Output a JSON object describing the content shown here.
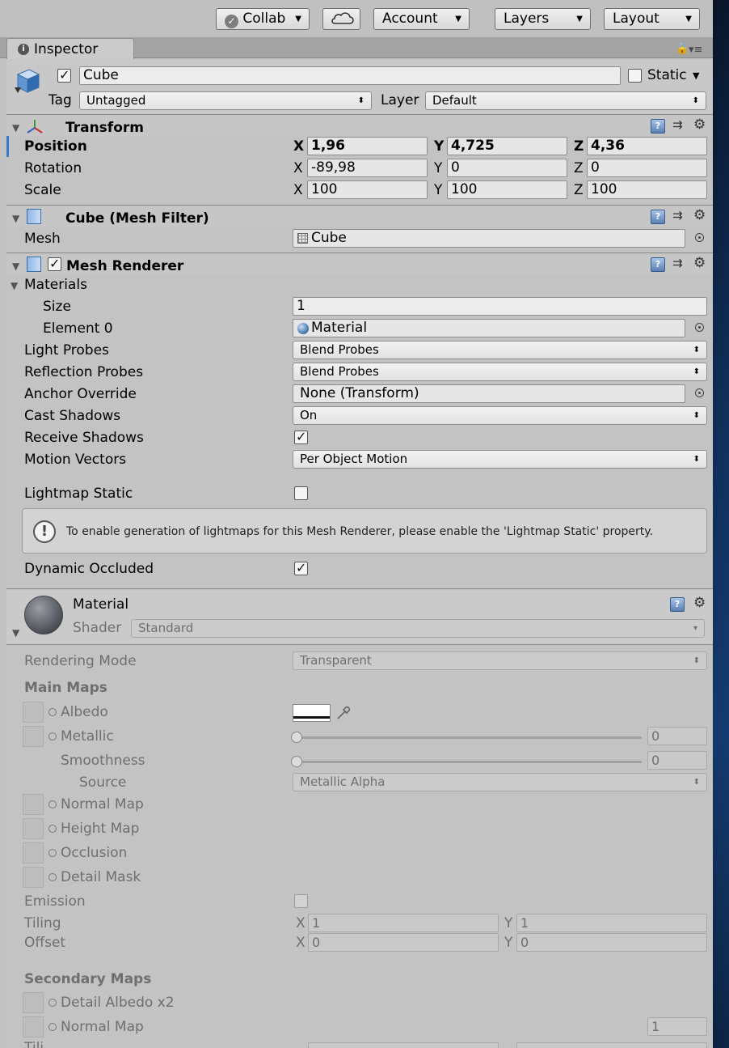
{
  "toolbar": {
    "collab": "Collab",
    "account": "Account",
    "layers": "Layers",
    "layout": "Layout"
  },
  "tab": {
    "title": "Inspector"
  },
  "object": {
    "name": "Cube",
    "active": true,
    "static_label": "Static",
    "static": false,
    "tag_label": "Tag",
    "tag": "Untagged",
    "layer_label": "Layer",
    "layer": "Default"
  },
  "transform": {
    "title": "Transform",
    "position_label": "Position",
    "rotation_label": "Rotation",
    "scale_label": "Scale",
    "axis_x": "X",
    "axis_y": "Y",
    "axis_z": "Z",
    "position": {
      "x": "1,96",
      "y": "4,725",
      "z": "4,36"
    },
    "rotation": {
      "x": "-89,98",
      "y": "0",
      "z": "0"
    },
    "scale": {
      "x": "100",
      "y": "100",
      "z": "100"
    }
  },
  "mesh_filter": {
    "title": "Cube (Mesh Filter)",
    "mesh_label": "Mesh",
    "mesh": "Cube"
  },
  "mesh_renderer": {
    "title": "Mesh Renderer",
    "enabled": true,
    "materials_label": "Materials",
    "size_label": "Size",
    "size": "1",
    "element0_label": "Element 0",
    "element0": "Material",
    "light_probes_label": "Light Probes",
    "light_probes": "Blend Probes",
    "reflection_probes_label": "Reflection Probes",
    "reflection_probes": "Blend Probes",
    "anchor_override_label": "Anchor Override",
    "anchor_override": "None (Transform)",
    "cast_shadows_label": "Cast Shadows",
    "cast_shadows": "On",
    "receive_shadows_label": "Receive Shadows",
    "receive_shadows": true,
    "motion_vectors_label": "Motion Vectors",
    "motion_vectors": "Per Object Motion",
    "lightmap_static_label": "Lightmap Static",
    "lightmap_static": false,
    "info_message": "To enable generation of lightmaps for this Mesh Renderer, please enable the 'Lightmap Static' property.",
    "dynamic_occluded_label": "Dynamic Occluded",
    "dynamic_occluded": true
  },
  "material": {
    "title": "Material",
    "shader_label": "Shader",
    "shader": "Standard",
    "rendering_mode_label": "Rendering Mode",
    "rendering_mode": "Transparent",
    "main_maps_label": "Main Maps",
    "albedo_label": "Albedo",
    "metallic_label": "Metallic",
    "metallic": "0",
    "smoothness_label": "Smoothness",
    "smoothness": "0",
    "source_label": "Source",
    "source": "Metallic Alpha",
    "normal_map_label": "Normal Map",
    "height_map_label": "Height Map",
    "occlusion_label": "Occlusion",
    "detail_mask_label": "Detail Mask",
    "emission_label": "Emission",
    "tiling_label": "Tiling",
    "tiling": {
      "x": "1",
      "y": "1"
    },
    "offset_label": "Offset",
    "offset": {
      "x": "0",
      "y": "0"
    },
    "secondary_maps_label": "Secondary Maps",
    "detail_albedo_label": "Detail Albedo x2",
    "secondary_normal_label": "Normal Map",
    "secondary_normal_scale": "1",
    "tiling_cut": "Tili"
  }
}
